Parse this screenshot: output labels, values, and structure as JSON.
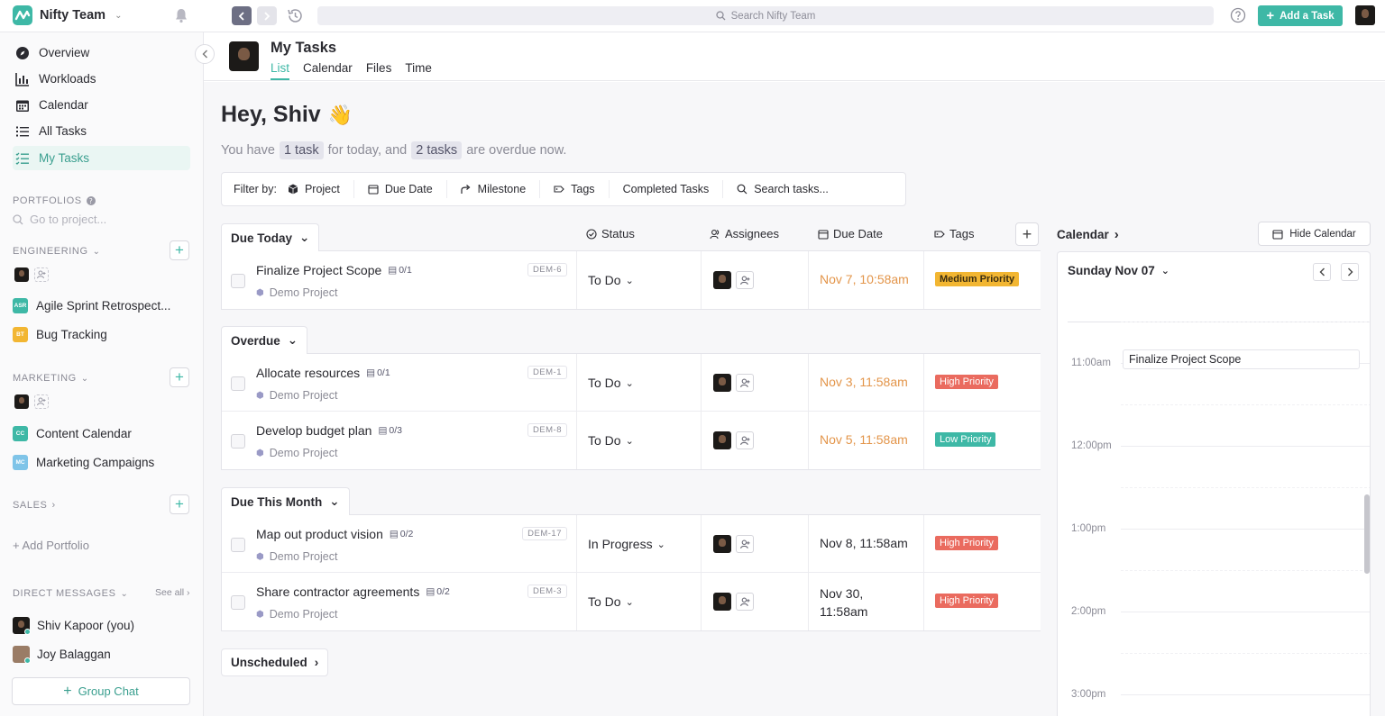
{
  "app": {
    "team_name": "Nifty Team"
  },
  "topbar": {
    "search_placeholder": "Search Nifty Team",
    "add_task_label": "Add a Task"
  },
  "sidebar": {
    "nav": [
      {
        "label": "Overview",
        "icon": "compass-icon"
      },
      {
        "label": "Workloads",
        "icon": "bar-chart-icon"
      },
      {
        "label": "Calendar",
        "icon": "calendar-icon"
      },
      {
        "label": "All Tasks",
        "icon": "list-icon"
      },
      {
        "label": "My Tasks",
        "icon": "checklist-icon",
        "active": true
      }
    ],
    "portfolios_label": "PORTFOLIOS",
    "goto_placeholder": "Go to project...",
    "engineering": {
      "label": "ENGINEERING",
      "projects": [
        {
          "badge": "ASR",
          "label": "Agile Sprint Retrospect...",
          "color": "#3eb8a6"
        },
        {
          "badge": "BT",
          "label": "Bug Tracking",
          "color": "#f2b632"
        }
      ]
    },
    "marketing": {
      "label": "MARKETING",
      "projects": [
        {
          "badge": "CC",
          "label": "Content Calendar",
          "color": "#3eb8a6"
        },
        {
          "badge": "MC",
          "label": "Marketing Campaigns",
          "color": "#7fc4e8"
        }
      ]
    },
    "sales": {
      "label": "SALES"
    },
    "add_portfolio": "+ Add Portfolio",
    "direct_messages": {
      "label": "DIRECT MESSAGES",
      "see_all": "See all",
      "people": [
        "Shiv Kapoor (you)",
        "Joy Balaggan"
      ]
    },
    "group_chat": "Group Chat"
  },
  "header": {
    "title": "My Tasks",
    "tabs": [
      "List",
      "Calendar",
      "Files",
      "Time"
    ],
    "active_tab": "List"
  },
  "greeting": {
    "title": "Hey, Shiv",
    "emoji": "👋",
    "line": {
      "p1": "You have",
      "chip1": "1 task",
      "p2": "for today, and",
      "chip2": "2 tasks",
      "p3": "are overdue now."
    }
  },
  "filters": {
    "label": "Filter by:",
    "items": [
      "Project",
      "Due Date",
      "Milestone",
      "Tags",
      "Completed Tasks",
      "Search tasks..."
    ]
  },
  "columns": {
    "status": "Status",
    "assignees": "Assignees",
    "due": "Due Date",
    "tags": "Tags"
  },
  "groups": [
    {
      "label": "Due Today",
      "tasks": [
        {
          "name": "Finalize Project Scope",
          "subtasks": "0/1",
          "project": "Demo Project",
          "id": "DEM-6",
          "status": "To Do",
          "due": "Nov 7, 10:58am",
          "late": true,
          "tag": "Medium Priority",
          "tag_level": "med"
        }
      ]
    },
    {
      "label": "Overdue",
      "tasks": [
        {
          "name": "Allocate resources",
          "subtasks": "0/1",
          "project": "Demo Project",
          "id": "DEM-1",
          "status": "To Do",
          "due": "Nov 3, 11:58am",
          "late": true,
          "tag": "High Priority",
          "tag_level": "high"
        },
        {
          "name": "Develop budget plan",
          "subtasks": "0/3",
          "project": "Demo Project",
          "id": "DEM-8",
          "status": "To Do",
          "due": "Nov 5, 11:58am",
          "late": true,
          "tag": "Low Priority",
          "tag_level": "low"
        }
      ]
    },
    {
      "label": "Due This Month",
      "tasks": [
        {
          "name": "Map out product vision",
          "subtasks": "0/2",
          "project": "Demo Project",
          "id": "DEM-17",
          "status": "In Progress",
          "due": "Nov 8, 11:58am",
          "late": false,
          "tag": "High Priority",
          "tag_level": "high"
        },
        {
          "name": "Share contractor agreements",
          "subtasks": "0/2",
          "project": "Demo Project",
          "id": "DEM-3",
          "status": "To Do",
          "due_line1": "Nov 30,",
          "due_line2": "11:58am",
          "late": false,
          "tag": "High Priority",
          "tag_level": "high"
        }
      ]
    }
  ],
  "unscheduled_label": "Unscheduled",
  "calendar": {
    "label": "Calendar",
    "hide_label": "Hide Calendar",
    "date": "Sunday Nov 07",
    "hours": [
      "11:00am",
      "12:00pm",
      "1:00pm",
      "2:00pm",
      "3:00pm"
    ],
    "event": "Finalize Project Scope"
  },
  "colors": {
    "accent": "#3eb8a6",
    "overdue": "#e3954a",
    "high": "#ea6b5f",
    "medium": "#f2b632",
    "low": "#3eb8a6"
  }
}
